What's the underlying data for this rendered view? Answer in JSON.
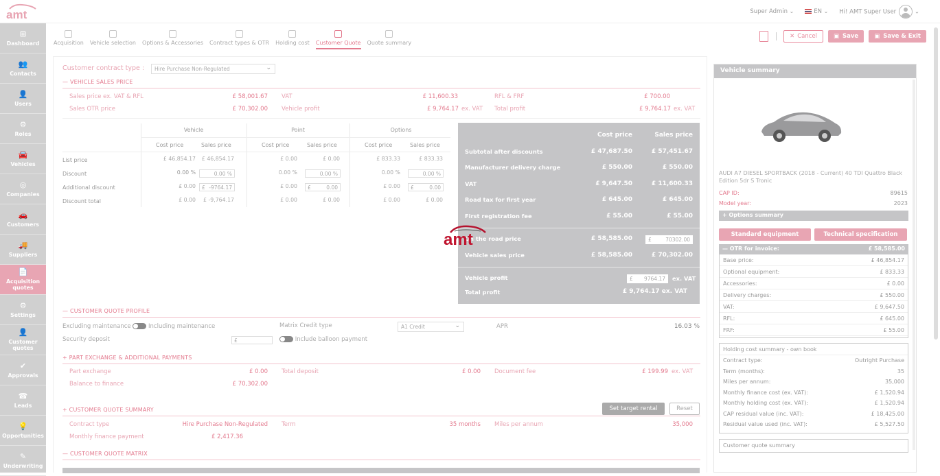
{
  "app": {
    "logo": "amt"
  },
  "topbar": {
    "role": "Super Admin",
    "lang": "EN",
    "greeting": "Hi! AMT Super User"
  },
  "sidebar": [
    {
      "label": "Dashboard",
      "icon": "dashboard-icon",
      "glyph": "⊞"
    },
    {
      "label": "Contacts",
      "icon": "contacts-icon",
      "glyph": "👥"
    },
    {
      "label": "Users",
      "icon": "user-icon",
      "glyph": "👤"
    },
    {
      "label": "Roles",
      "icon": "roles-icon",
      "glyph": "⚙"
    },
    {
      "label": "Vehicles",
      "icon": "car-icon",
      "glyph": "🚘"
    },
    {
      "label": "Companies",
      "icon": "companies-icon",
      "glyph": "◎"
    },
    {
      "label": "Customers",
      "icon": "customers-icon",
      "glyph": "🚗"
    },
    {
      "label": "Suppliers",
      "icon": "suppliers-icon",
      "glyph": "🚚"
    },
    {
      "label": "Acquisition quotes",
      "icon": "quote-icon",
      "glyph": "📄"
    },
    {
      "label": "Settings",
      "icon": "settings-icon",
      "glyph": "⚙"
    },
    {
      "label": "Customer quotes",
      "icon": "customer-quotes-icon",
      "glyph": "👤"
    },
    {
      "label": "Approvals",
      "icon": "approvals-icon",
      "glyph": "✔"
    },
    {
      "label": "Leads",
      "icon": "leads-icon",
      "glyph": "☎"
    },
    {
      "label": "Opportunities",
      "icon": "opportunities-icon",
      "glyph": "💡"
    },
    {
      "label": "Underwriting",
      "icon": "underwriting-icon",
      "glyph": "✎"
    }
  ],
  "steps": [
    "Acquisition",
    "Vehicle selection",
    "Options & Accessories",
    "Contract types & OTR",
    "Holding cost",
    "Customer Quote",
    "Quote summary"
  ],
  "actions": {
    "cancel": "Cancel",
    "save": "Save",
    "save_exit": "Save & Exit"
  },
  "main": {
    "contract_type_label": "Customer contract type :",
    "contract_type_value": "Hire Purchase Non-Regulated",
    "vehicle_sales_price": {
      "title": "VEHICLE SALES PRICE",
      "sales_price_label": "Sales price ex. VAT & RFL",
      "sales_price": "£ 58,001.67",
      "vat_label": "VAT",
      "vat": "£ 11,600.33",
      "rfl_label": "RFL & FRF",
      "rfl": "£ 700.00",
      "otr_label": "Sales OTR price",
      "otr": "£ 70,302.00",
      "profit_label": "Vehicle profit",
      "profit": "£ 9,764.17",
      "profit_suffix": "ex. VAT",
      "total_profit_label": "Total profit",
      "total_profit": "£ 9,764.17",
      "total_profit_suffix": "ex. VAT"
    },
    "pricing": {
      "groups": [
        "Vehicle",
        "Point",
        "Options"
      ],
      "cost": "Cost price",
      "sales": "Sales price",
      "rows": [
        "List price",
        "Discount",
        "Additional discount",
        "Discount total"
      ],
      "list": [
        "£ 46,854.17",
        "£ 46,854.17",
        "£ 0.00",
        "£ 0.00",
        "£ 833.33",
        "£ 833.33"
      ],
      "discount": [
        "0.00 %",
        "0.00 %",
        "0.00 %",
        "0.00 %",
        "0.00 %",
        "0.00 %"
      ],
      "add_discount": [
        "£ 0.00",
        "-9764.17",
        "£ 0.00",
        "0.00",
        "£ 0.00",
        "0.00"
      ],
      "discount_total": [
        "£ 0.00",
        "£ -9,764.17",
        "£ 0.00",
        "£ 0.00",
        "£ 0.00",
        "£ 0.00"
      ],
      "currency": "£"
    },
    "summary": {
      "cost_header": "Cost price",
      "sales_header": "Sales price",
      "rows": [
        {
          "label": "Subtotal after discounts",
          "cost": "£ 47,687.50",
          "sales": "£ 57,451.67"
        },
        {
          "label": "Manufacturer delivery charge",
          "cost": "£ 550.00",
          "sales": "£ 550.00"
        },
        {
          "label": "VAT",
          "cost": "£ 9,647.50",
          "sales": "£ 11,600.33"
        },
        {
          "label": "Road tax for first year",
          "cost": "£ 645.00",
          "sales": "£ 645.00"
        },
        {
          "label": "First registration fee",
          "cost": "£ 55.00",
          "sales": "£ 55.00"
        }
      ],
      "otr_label": "On the road price",
      "otr_cost": "£ 58,585.00",
      "otr_sales_input": "70302.00",
      "vsp_label": "Vehicle sales price",
      "vsp_cost": "£ 58,585.00",
      "vsp_sales": "£ 70,302.00",
      "vp_label": "Vehicle profit",
      "vp_input": "9764.17",
      "vp_suffix": "ex. VAT",
      "tp_label": "Total profit",
      "tp": "£ 9,764.17 ex. VAT"
    },
    "profile": {
      "title": "CUSTOMER QUOTE PROFILE",
      "excl": "Excluding maintenance",
      "incl": "Including maintenance",
      "matrix_label": "Matrix Credit type",
      "matrix_value": "A1 Credit",
      "apr_label": "APR",
      "apr": "16.03 %",
      "security_label": "Security deposit",
      "balloon": "Include balloon payment"
    },
    "part_exchange": {
      "title": "PART EXCHANGE & ADDITIONAL PAYMENTS",
      "px_label": "Part exchange",
      "px": "£ 0.00",
      "td_label": "Total deposit",
      "td": "£ 0.00",
      "fee_label": "Document fee",
      "fee": "£ 199.99",
      "fee_suffix": "ex. VAT",
      "bal_label": "Balance to finance",
      "bal": "£ 70,302.00"
    },
    "quote_summary": {
      "title": "CUSTOMER QUOTE SUMMARY",
      "set_target": "Set target rental",
      "reset": "Reset",
      "ct_label": "Contract type",
      "ct": "Hire Purchase Non-Regulated",
      "term_label": "Term",
      "term": "35 months",
      "miles_label": "Miles per annum",
      "miles": "35,000",
      "mfp_label": "Monthly finance payment",
      "mfp": "£ 2,417.36"
    },
    "matrix": {
      "title": "CUSTOMER QUOTE MATRIX"
    }
  },
  "vehicle_summary": {
    "title": "Vehicle summary",
    "name": "AUDI A7 DIESEL SPORTBACK (2018 - Current) 40 TDI Quattro Black Edition 5dr S Tronic",
    "cap_label": "CAP ID:",
    "cap": "89615",
    "year_label": "Model year:",
    "year": "2023",
    "options_summary": "Options summary",
    "std_equipment": "Standard equipment",
    "tech_spec": "Technical specification",
    "otr_label": "OTR for invoice:",
    "otr": "£ 58,585.00",
    "otr_rows": [
      {
        "label": "Base price:",
        "value": "£ 46,854.17"
      },
      {
        "label": "Optional equipment:",
        "value": "£ 833.33"
      },
      {
        "label": "Accessories:",
        "value": "£ 0.00"
      },
      {
        "label": "Delivery charges:",
        "value": "£ 550.00"
      },
      {
        "label": "VAT:",
        "value": "£ 9,647.50"
      },
      {
        "label": "RFL:",
        "value": "£ 645.00"
      },
      {
        "label": "FRF:",
        "value": "£ 55.00"
      }
    ],
    "holding_title": "Holding cost summary - own book",
    "holding_rows": [
      {
        "label": "Contract type:",
        "value": "Outright Purchase"
      },
      {
        "label": "Term (months):",
        "value": "35"
      },
      {
        "label": "Miles per annum:",
        "value": "35,000"
      },
      {
        "label": "Monthly finance cost (ex. VAT):",
        "value": "£ 1,520.94"
      },
      {
        "label": "Monthly holding cost (ex. VAT):",
        "value": "£ 1,520.94"
      },
      {
        "label": "CAP residual value (inc. VAT):",
        "value": "£ 18,425.00"
      },
      {
        "label": "Residual value used (inc. VAT):",
        "value": "£ 5,527.50"
      }
    ],
    "customer_quote_summary": "Customer quote summary"
  },
  "colors": {
    "accent": "#e8a5b3",
    "accent_dark": "#e37a8e",
    "gray_panel": "#c5c5c7"
  }
}
